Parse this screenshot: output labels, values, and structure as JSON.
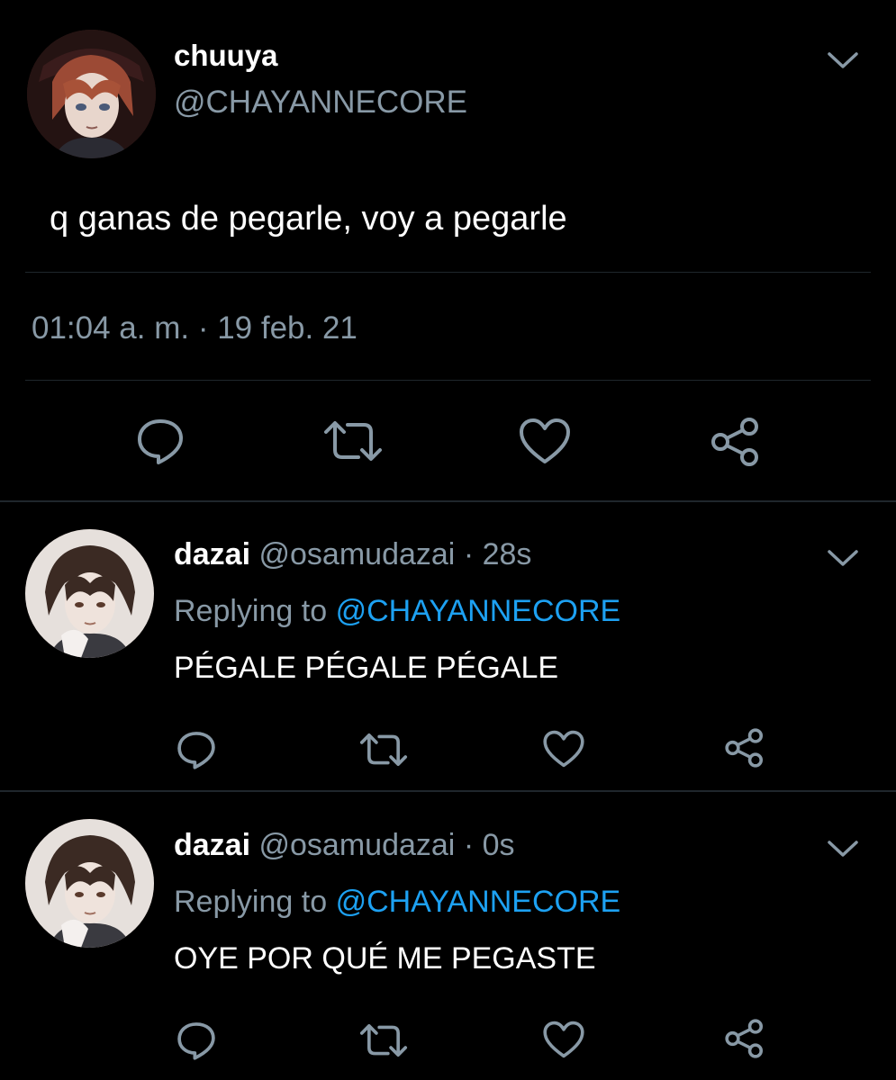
{
  "main_tweet": {
    "author_name": "chuuya",
    "author_handle": "@CHAYANNECORE",
    "text": "q ganas de pegarle, voy a pegarle",
    "timestamp": "01:04 a. m. · 19 feb. 21",
    "avatar_icon": "anime-avatar-chuuya",
    "actions": [
      "reply-icon",
      "retweet-icon",
      "like-icon",
      "share-icon"
    ]
  },
  "replies": [
    {
      "author_name": "dazai",
      "author_handle": "@osamudazai",
      "time": "· 28s",
      "replying_label": "Replying to",
      "replying_to": "@CHAYANNECORE",
      "text": "PÉGALE PÉGALE PÉGALE",
      "avatar_icon": "anime-avatar-dazai"
    },
    {
      "author_name": "dazai",
      "author_handle": "@osamudazai",
      "time": "· 0s",
      "replying_label": "Replying to",
      "replying_to": "@CHAYANNECORE",
      "text": "OYE POR QUÉ ME PEGASTE",
      "avatar_icon": "anime-avatar-dazai"
    }
  ],
  "colors": {
    "background": "#000000",
    "secondary_text": "#8899a6",
    "link": "#1da1f2",
    "divider": "#1f262c"
  }
}
